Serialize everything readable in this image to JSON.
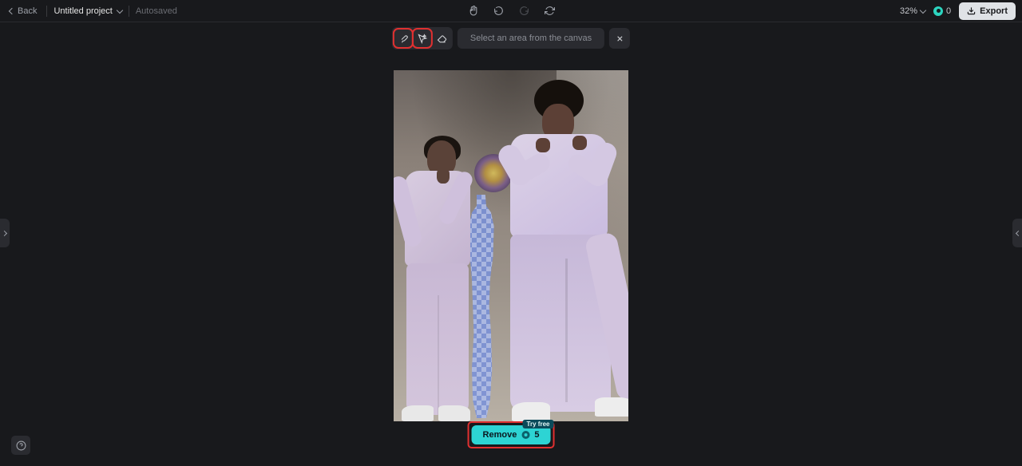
{
  "header": {
    "back_label": "Back",
    "project_name": "Untitled project",
    "autosave_label": "Autosaved",
    "zoom": "32%",
    "credits": "0",
    "export_label": "Export"
  },
  "toolbar": {
    "prompt": "Select an area from the canvas"
  },
  "action": {
    "remove_label": "Remove",
    "remove_cost": "5",
    "badge": "Try free"
  }
}
